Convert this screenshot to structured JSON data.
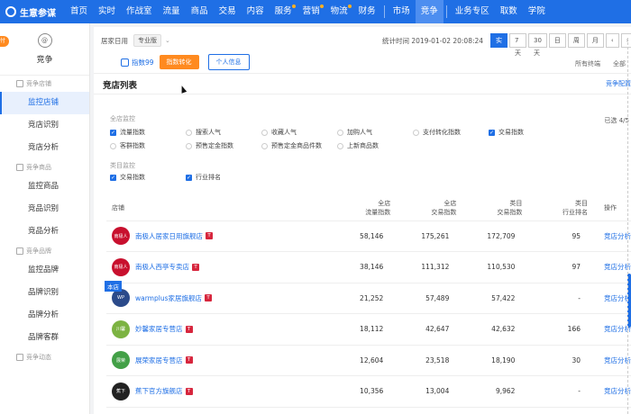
{
  "brand": {
    "title": "生意参谋"
  },
  "nav": [
    "首页",
    "实时",
    "作战室",
    "流量",
    "商品",
    "交易",
    "内容",
    "服务",
    "营销",
    "物流",
    "财务",
    "市场",
    "竞争",
    "业务专区",
    "取数",
    "学院"
  ],
  "nav_active": "竞争",
  "sidebar": {
    "tab_label": "付",
    "icon_label": "@",
    "title": "竞争",
    "groups": [
      {
        "label": "竞争店铺",
        "items": [
          "监控店铺",
          "竞店识别",
          "竞店分析"
        ]
      },
      {
        "label": "竞争商品",
        "items": [
          "监控商品",
          "竞品识别",
          "竞品分析"
        ]
      },
      {
        "label": "竞争品牌",
        "items": [
          "监控品牌",
          "品牌识别",
          "品牌分析",
          "品牌客群"
        ]
      },
      {
        "label": "竞争动态",
        "items": []
      }
    ],
    "active_item": "监控店铺"
  },
  "filterbar": {
    "category": "居家日用",
    "level": "专业版",
    "stat_time": "统计时间 2019-01-02 20:08:24",
    "time_buttons": [
      "实时",
      "7天",
      "30天",
      "日",
      "周",
      "月"
    ],
    "time_active": "实时",
    "index_label": "指数99",
    "btn_convert": "指数转化",
    "btn_personal": "个人信息",
    "terminal": "所有终端",
    "all": "全部"
  },
  "panel": {
    "title": "竞店列表",
    "config": "竞争配置",
    "section1": "全店监控",
    "section2": "类目监控",
    "selected": "已选 4/5",
    "checks_row1": [
      {
        "label": "流量指数",
        "on": true
      },
      {
        "label": "搜索人气",
        "on": false
      },
      {
        "label": "收藏人气",
        "on": false
      },
      {
        "label": "加购人气",
        "on": false
      },
      {
        "label": "支付转化指数",
        "on": false
      },
      {
        "label": "交易指数",
        "on": true
      }
    ],
    "checks_row2": [
      {
        "label": "客群指数",
        "on": false
      },
      {
        "label": "预售定金指数",
        "on": false
      },
      {
        "label": "预售定金商品件数",
        "on": false
      },
      {
        "label": "上新商品数",
        "on": false
      }
    ],
    "checks_row3": [
      {
        "label": "交易指数",
        "on": true
      },
      {
        "label": "行业排名",
        "on": true
      }
    ]
  },
  "table": {
    "headers": [
      "店铺",
      "全店\n流量指数",
      "全店\n交易指数",
      "类目\n交易指数",
      "类目\n行业排名",
      "操作"
    ],
    "rows": [
      {
        "name": "南极人居家日用旗舰店",
        "logo_color": "#c8102e",
        "logo_text": "南极人",
        "c1": "58,146",
        "c2": "175,261",
        "c3": "172,709",
        "c4": "95",
        "op": "竞店分析"
      },
      {
        "name": "南极人西亭专卖店",
        "logo_color": "#c8102e",
        "logo_text": "南极人",
        "c1": "38,146",
        "c2": "111,312",
        "c3": "110,530",
        "c4": "97",
        "op": "竞店分析"
      },
      {
        "name": "warmplus家居旗舰店",
        "logo_color": "#2b4a8a",
        "logo_text": "WP",
        "c1": "21,252",
        "c2": "57,489",
        "c3": "57,422",
        "c4": "-",
        "op": "竞店分析"
      },
      {
        "name": "妙馨家居专营店",
        "logo_color": "#7cb342",
        "logo_text": "川馨",
        "c1": "18,112",
        "c2": "42,647",
        "c3": "42,632",
        "c4": "166",
        "op": "竞店分析"
      },
      {
        "name": "展荣家居专营店",
        "logo_color": "#43a047",
        "logo_text": "展荣",
        "c1": "12,604",
        "c2": "23,518",
        "c3": "18,190",
        "c4": "30",
        "op": "竞店分析"
      },
      {
        "name": "蕉下官方旗舰店",
        "logo_color": "#222222",
        "logo_text": "蕉下",
        "c1": "10,356",
        "c2": "13,004",
        "c3": "9,962",
        "c4": "-",
        "op": "竞店分析"
      }
    ],
    "badge": "本店"
  }
}
